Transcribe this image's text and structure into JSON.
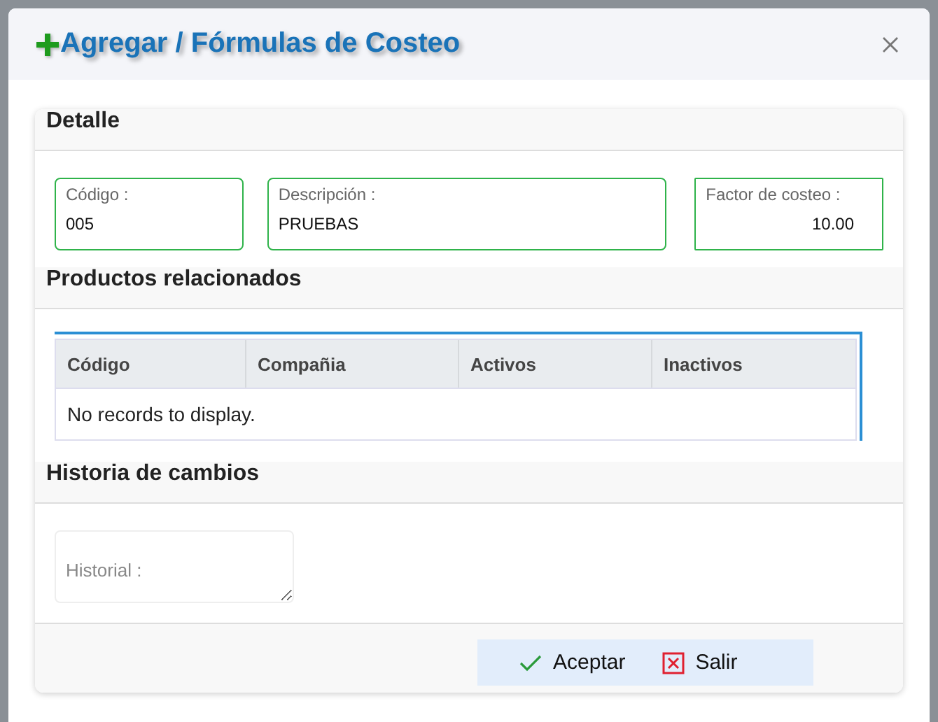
{
  "dialog": {
    "title": "Agregar / Fórmulas de Costeo"
  },
  "detalle": {
    "heading": "Detalle",
    "fields": [
      {
        "label": "Código :",
        "value": "005",
        "kind": "text"
      },
      {
        "label": "Descripción :",
        "value": "PRUEBAS",
        "kind": "text"
      },
      {
        "label": "Factor de costeo :",
        "value": "10.00",
        "kind": "number"
      }
    ]
  },
  "productos": {
    "heading": "Productos relacionados",
    "table": {
      "columns": [
        "Código",
        "Compañia",
        "Activos",
        "Inactivos"
      ],
      "empty_message": "No records to display."
    }
  },
  "historia": {
    "heading": "Historia de cambios",
    "field": {
      "placeholder": "Historial :"
    }
  },
  "buttons": [
    {
      "label": "Aceptar",
      "kind": "accept"
    },
    {
      "label": "Salir",
      "kind": "exit"
    }
  ]
}
